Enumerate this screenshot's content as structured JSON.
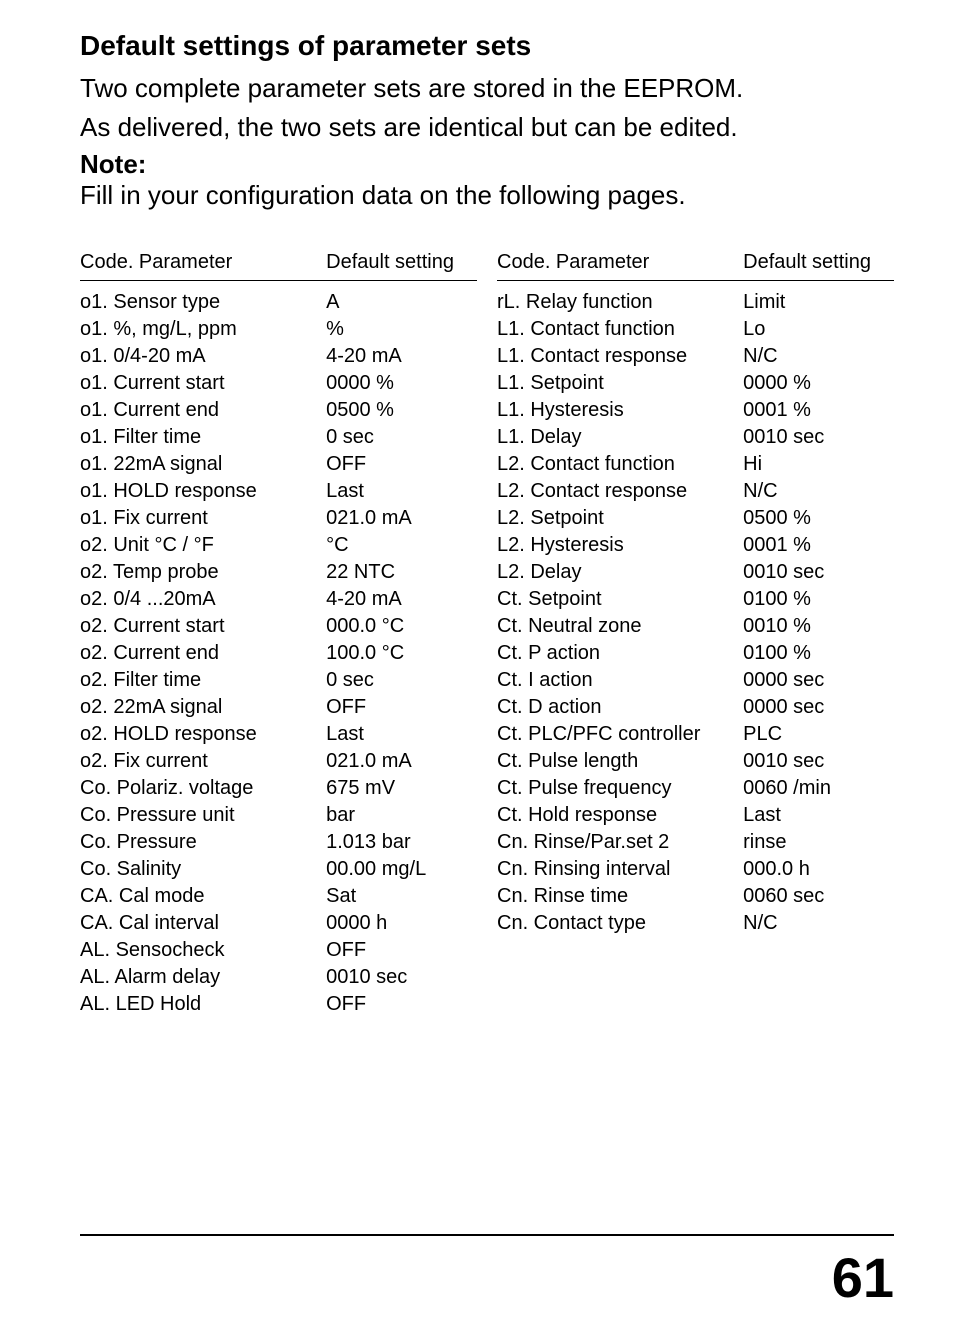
{
  "title": "Default settings of parameter sets",
  "intro_line1": "Two complete parameter sets are stored in the EEPROM.",
  "intro_line2": "As delivered, the two sets are identical but can be edited.",
  "note_label": "Note:",
  "note_text": "Fill in your configuration data on the following pages.",
  "headers": {
    "param": "Code. Parameter",
    "def": "Default setting"
  },
  "left_rows": [
    {
      "p": "o1. Sensor type",
      "d": "A"
    },
    {
      "p": "o1. %, mg/L, ppm",
      "d": "%"
    },
    {
      "p": "o1. 0/4-20 mA",
      "d": "4-20 mA"
    },
    {
      "p": "o1. Current start",
      "d": "0000 %"
    },
    {
      "p": "o1. Current end",
      "d": "0500 %"
    },
    {
      "p": "o1. Filter time",
      "d": "0 sec"
    },
    {
      "p": "o1. 22mA signal",
      "d": "OFF"
    },
    {
      "p": "o1. HOLD response",
      "d": "Last"
    },
    {
      "p": "o1. Fix current",
      "d": "021.0 mA"
    },
    {
      "p": "o2. Unit °C / °F",
      "d": "°C"
    },
    {
      "p": "o2. Temp probe",
      "d": "22 NTC"
    },
    {
      "p": "o2. 0/4 ...20mA",
      "d": "4-20 mA"
    },
    {
      "p": "o2. Current start",
      "d": "000.0 °C"
    },
    {
      "p": "o2. Current end",
      "d": "100.0 °C"
    },
    {
      "p": "o2. Filter time",
      "d": "0 sec"
    },
    {
      "p": "o2. 22mA signal",
      "d": "OFF"
    },
    {
      "p": "o2. HOLD response",
      "d": "Last"
    },
    {
      "p": "o2. Fix current",
      "d": "021.0 mA"
    },
    {
      "p": "Co. Polariz. voltage",
      "d": "675 mV"
    },
    {
      "p": "Co. Pressure unit",
      "d": "bar"
    },
    {
      "p": "Co. Pressure",
      "d": "1.013 bar"
    },
    {
      "p": "Co. Salinity",
      "d": "00.00 mg/L"
    },
    {
      "p": "CA. Cal mode",
      "d": "Sat"
    },
    {
      "p": "CA. Cal interval",
      "d": "0000 h"
    },
    {
      "p": "AL. Sensocheck",
      "d": "OFF"
    },
    {
      "p": "AL. Alarm delay",
      "d": "0010 sec"
    },
    {
      "p": "AL. LED Hold",
      "d": "OFF"
    }
  ],
  "right_rows": [
    {
      "p": "rL. Relay function",
      "d": "Limit"
    },
    {
      "p": "L1. Contact function",
      "d": "Lo"
    },
    {
      "p": "L1. Contact response",
      "d": "N/C"
    },
    {
      "p": "L1. Setpoint",
      "d": "0000 %"
    },
    {
      "p": "L1. Hysteresis",
      "d": "0001 %"
    },
    {
      "p": "L1. Delay",
      "d": "0010 sec"
    },
    {
      "p": "L2. Contact function",
      "d": "Hi"
    },
    {
      "p": "L2. Contact response",
      "d": "N/C"
    },
    {
      "p": "L2. Setpoint",
      "d": "0500 %"
    },
    {
      "p": "L2. Hysteresis",
      "d": "0001 %"
    },
    {
      "p": "L2. Delay",
      "d": "0010 sec"
    },
    {
      "p": "Ct. Setpoint",
      "d": "0100 %"
    },
    {
      "p": "Ct. Neutral zone",
      "d": "0010 %"
    },
    {
      "p": "Ct. P action",
      "d": "0100 %"
    },
    {
      "p": "Ct. I action",
      "d": "0000 sec"
    },
    {
      "p": "Ct. D action",
      "d": "0000 sec"
    },
    {
      "p": "Ct. PLC/PFC controller",
      "d": "PLC"
    },
    {
      "p": "Ct. Pulse length",
      "d": "0010 sec"
    },
    {
      "p": "Ct. Pulse frequency",
      "d": "0060 /min"
    },
    {
      "p": "Ct. Hold response",
      "d": "Last"
    },
    {
      "p": "Cn. Rinse/Par.set 2",
      "d": "rinse"
    },
    {
      "p": "Cn. Rinsing interval",
      "d": "000.0 h"
    },
    {
      "p": "Cn. Rinse time",
      "d": "0060 sec"
    },
    {
      "p": "Cn. Contact type",
      "d": "N/C"
    }
  ],
  "page_number": "61"
}
